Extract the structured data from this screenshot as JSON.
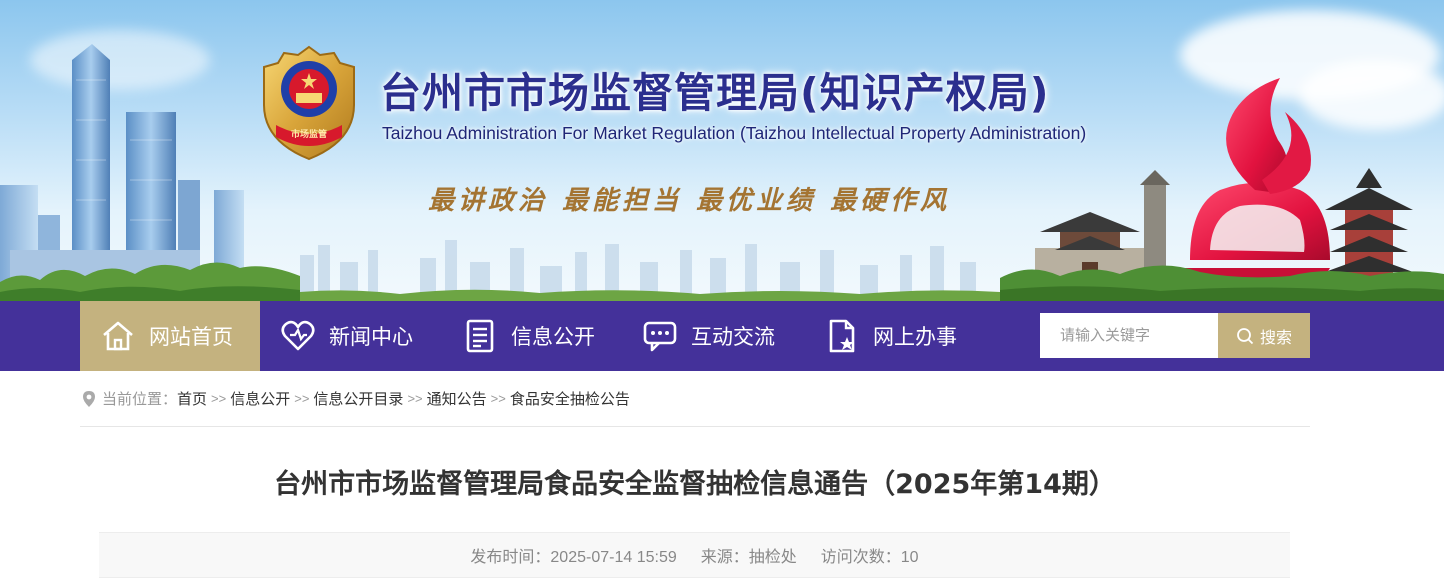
{
  "header": {
    "title_cn": "台州市市场监督管理局(知识产权局)",
    "title_en": "Taizhou Administration For Market Regulation (Taizhou Intellectual Property Administration)",
    "emblem_text": "市场监管",
    "slogans": [
      "最讲政治",
      "最能担当",
      "最优业绩",
      "最硬作风"
    ]
  },
  "nav": {
    "items": [
      {
        "label": "网站首页",
        "icon": "home-icon",
        "active": true
      },
      {
        "label": "新闻中心",
        "icon": "heart-icon",
        "active": false
      },
      {
        "label": "信息公开",
        "icon": "document-icon",
        "active": false
      },
      {
        "label": "互动交流",
        "icon": "chat-icon",
        "active": false
      },
      {
        "label": "网上办事",
        "icon": "file-star-icon",
        "active": false
      }
    ],
    "search_placeholder": "请输入关键字",
    "search_label": "搜索"
  },
  "breadcrumb": {
    "label": "当前位置：",
    "items": [
      "首页",
      "信息公开",
      "信息公开目录",
      "通知公告",
      "食品安全抽检公告"
    ],
    "separator": ">>"
  },
  "article": {
    "title": "台州市市场监督管理局食品安全监督抽检信息通告（2025年第14期）",
    "publish_time": "发布时间：2025-07-14 15:59",
    "source": "来源：抽检处",
    "visits": "访问次数：10"
  },
  "colors": {
    "nav_bg": "#44319a",
    "accent_gold": "#c4b27f",
    "title_blue": "#2b2f8e",
    "slogan_brown": "#a47432"
  }
}
